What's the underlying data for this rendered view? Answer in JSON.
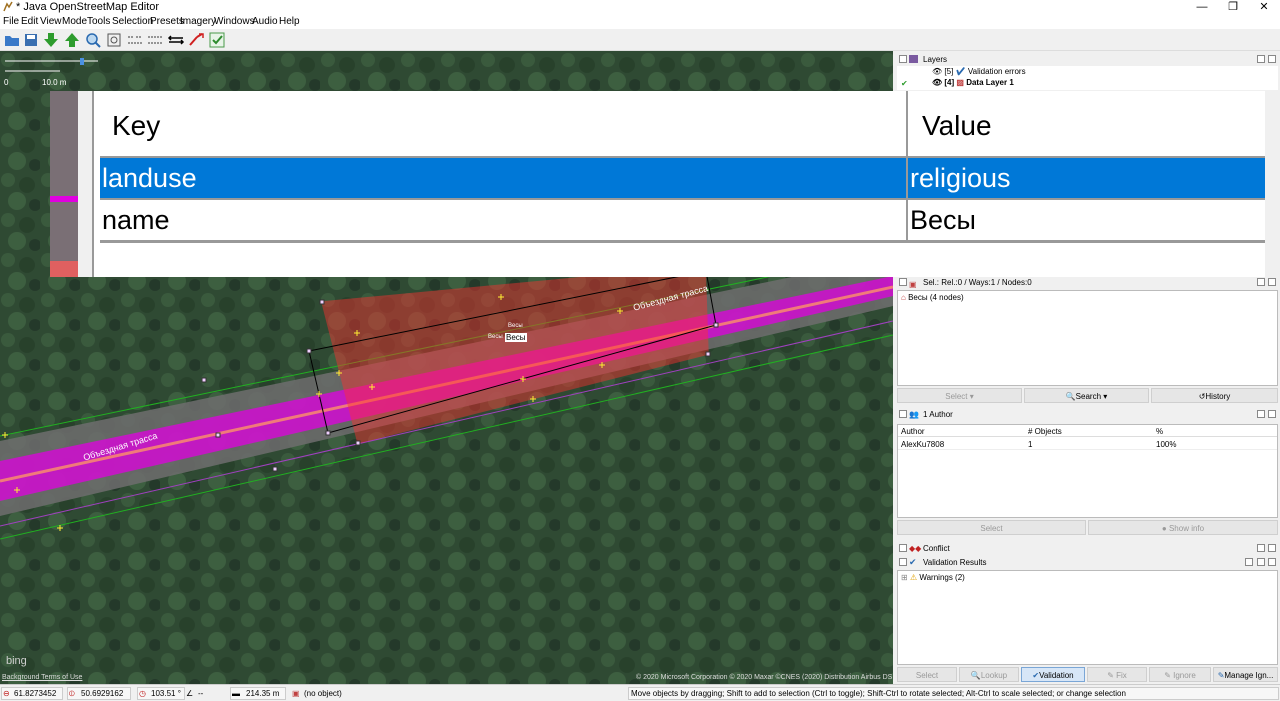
{
  "window": {
    "title": "* Java OpenStreetMap Editor",
    "controls": [
      "—",
      "❐",
      "✕"
    ]
  },
  "menu": [
    "File",
    "Edit",
    "View",
    "Mode",
    "Tools",
    "Selection",
    "Presets",
    "Imagery",
    "Windows",
    "Audio",
    "Help"
  ],
  "map": {
    "scale_start": "0",
    "scale_end": "10.0 m",
    "road_label": "Объездная трасса",
    "area_label_top": "Весы",
    "area_label_mid": "Весы",
    "area_label_name": "Весы",
    "bing_logo": "bing",
    "background_terms": "Background Terms of Use",
    "copyright": "© 2020 Microsoft Corporation © 2020 Maxar ©CNES (2020) Distribution Airbus DS"
  },
  "tags": {
    "header_key": "Key",
    "header_value": "Value",
    "rows": [
      {
        "key": "landuse",
        "value": "religious"
      },
      {
        "key": "name",
        "value": "Весы"
      }
    ]
  },
  "layers": {
    "title": "Layers",
    "items": [
      {
        "index": "[5]",
        "name": "Validation errors"
      },
      {
        "index": "[4]",
        "name": "Data Layer 1"
      }
    ]
  },
  "selection": {
    "title": "Sel.: Rel.:0 / Ways:1 / Nodes:0",
    "items": [
      "Весы (4 nodes)"
    ],
    "buttons": {
      "select": "Select",
      "search": "Search",
      "history": "History"
    }
  },
  "authors": {
    "title": "1 Author",
    "columns": [
      "Author",
      "# Objects",
      "%"
    ],
    "rows": [
      [
        "AlexKu7808",
        "1",
        "100%"
      ]
    ],
    "buttons": {
      "select": "Select",
      "show_info": "Show info"
    }
  },
  "conflict": {
    "title": "Conflict"
  },
  "validation": {
    "title": "Validation Results",
    "tree": [
      "Warnings (2)"
    ],
    "buttons": {
      "select": "Select",
      "lookup": "Lookup",
      "validation": "Validation",
      "fix": "Fix",
      "ignore": "Ignore",
      "manage": "Manage Ign..."
    }
  },
  "status": {
    "lat": "61.8273452",
    "lon": "50.6929162",
    "heading": "103.51 °",
    "angle": "--",
    "distance": "214.35 m",
    "object": "(no object)",
    "help": "Move objects by dragging; Shift to add to selection (Ctrl to toggle); Shift-Ctrl to rotate selected; Alt-Ctrl to scale selected; or change selection"
  },
  "colors": {
    "selection_blue": "#0078d7",
    "road_magenta": "#e000e0",
    "area_red": "#ff3030"
  }
}
